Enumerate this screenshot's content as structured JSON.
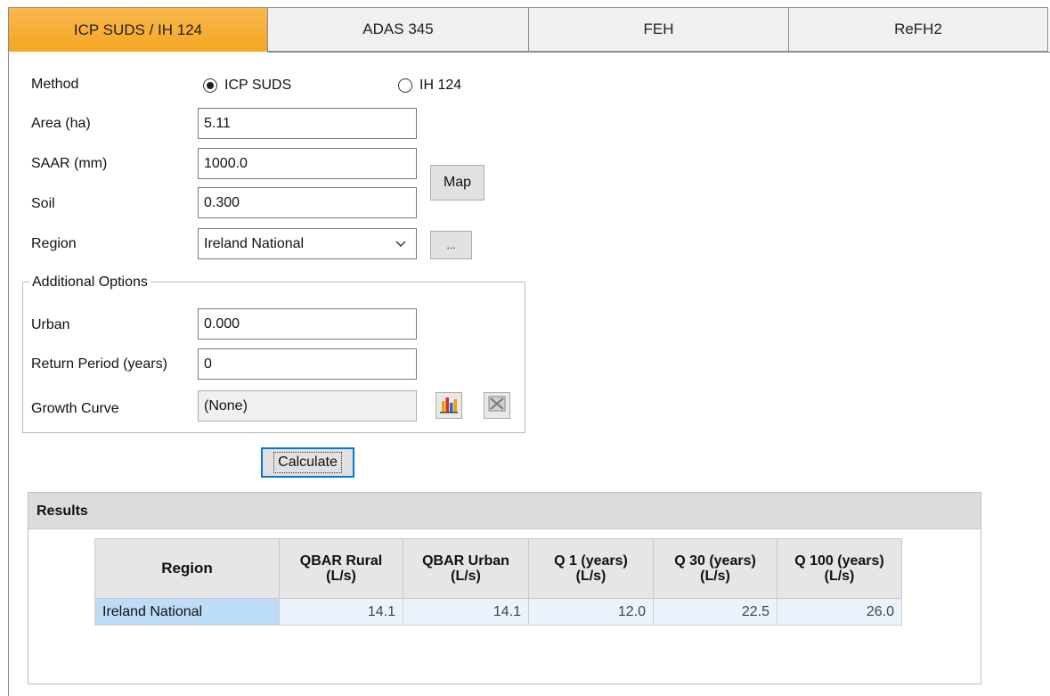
{
  "tabs": [
    {
      "label": "ICP SUDS / IH 124"
    },
    {
      "label": "ADAS 345"
    },
    {
      "label": "FEH"
    },
    {
      "label": "ReFH2"
    }
  ],
  "form": {
    "method_label": "Method",
    "method_options": [
      "ICP SUDS",
      "IH 124"
    ],
    "method_selected": "ICP SUDS",
    "area_label": "Area (ha)",
    "area_value": "5.11",
    "saar_label": "SAAR (mm)",
    "saar_value": "1000.0",
    "map_button": "Map",
    "soil_label": "Soil",
    "soil_value": "0.300",
    "region_label": "Region",
    "region_value": "Ireland National",
    "region_more_button": "..."
  },
  "additional": {
    "title": "Additional Options",
    "urban_label": "Urban",
    "urban_value": "0.000",
    "return_period_label": "Return Period (years)",
    "return_period_value": "0",
    "growth_curve_label": "Growth Curve",
    "growth_curve_value": "(None)"
  },
  "calculate_button": "Calculate",
  "results": {
    "title": "Results",
    "columns": [
      "Region",
      "QBAR Rural\n(L/s)",
      "QBAR Urban\n(L/s)",
      "Q 1 (years)\n(L/s)",
      "Q 30 (years)\n(L/s)",
      "Q 100 (years)\n(L/s)"
    ],
    "rows": [
      [
        "Ireland National",
        "14.1",
        "14.1",
        "12.0",
        "22.5",
        "26.0"
      ]
    ]
  },
  "icons": {
    "growth_curve_chart": "bar-chart-icon",
    "growth_curve_clear": "clear-chart-icon",
    "region_dropdown": "chevron-down-icon"
  },
  "colors": {
    "active_tab": "#f5a623",
    "selection": "#bcdcf7",
    "focus": "#0078d7"
  }
}
